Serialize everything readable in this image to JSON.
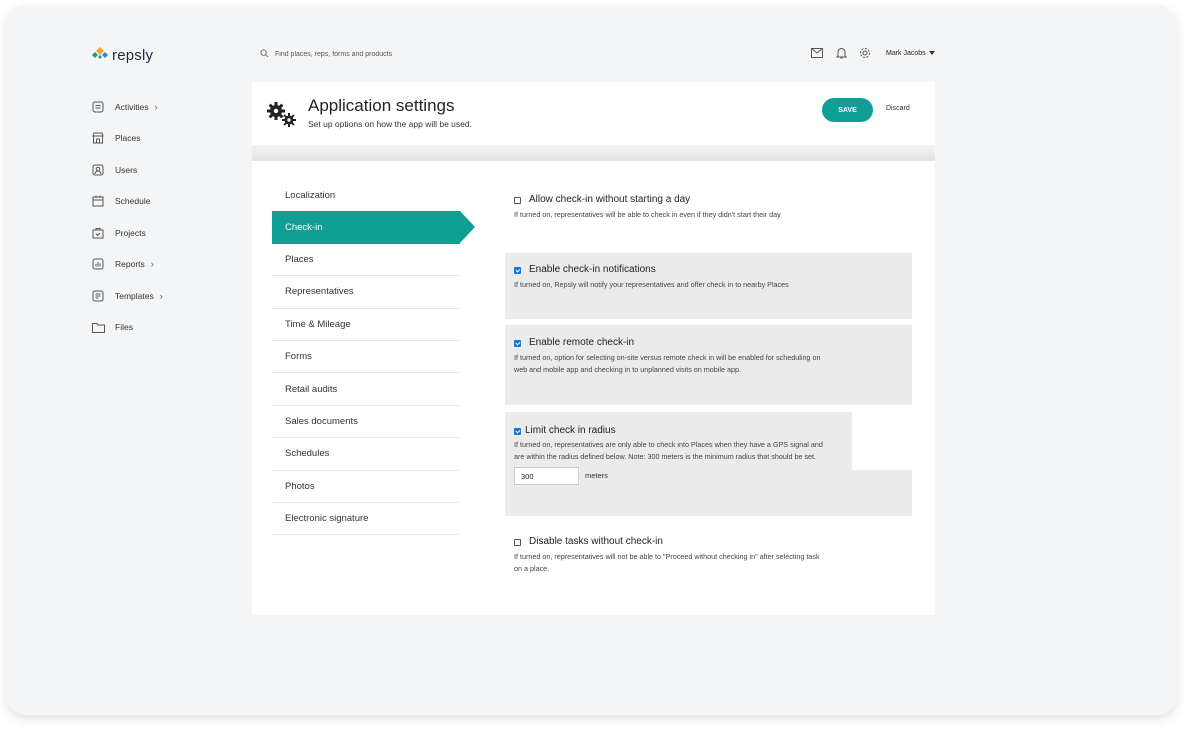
{
  "app": {
    "name": "repsly",
    "brand_color": "#0f9f95"
  },
  "search": {
    "placeholder": "Find places, reps, forms and products"
  },
  "user": {
    "name": "Mark Jacobs"
  },
  "icons": [
    "mail-icon",
    "bell-icon",
    "gear-icon",
    "search-icon",
    "caret-down-icon"
  ],
  "sidebar": {
    "items": [
      {
        "label": "Activities",
        "icon": "activities-icon",
        "has_chevron": true
      },
      {
        "label": "Places",
        "icon": "store-icon",
        "has_chevron": false
      },
      {
        "label": "Users",
        "icon": "user-icon",
        "has_chevron": false
      },
      {
        "label": "Schedule",
        "icon": "calendar-icon",
        "has_chevron": false
      },
      {
        "label": "Projects",
        "icon": "projects-icon",
        "has_chevron": false
      },
      {
        "label": "Reports",
        "icon": "chart-icon",
        "has_chevron": true
      },
      {
        "label": "Templates",
        "icon": "templates-icon",
        "has_chevron": true
      },
      {
        "label": "Files",
        "icon": "folder-icon",
        "has_chevron": false
      }
    ]
  },
  "header": {
    "title": "Application settings",
    "subtitle": "Set up options on how the app will be used.",
    "save_label": "SAVE",
    "discard_label": "Discard"
  },
  "settings_nav": {
    "active": "Check-in",
    "items": [
      "Localization",
      "Check-in",
      "Places",
      "Representatives",
      "Time & Mileage",
      "Forms",
      "Retail audits",
      "Sales documents",
      "Schedules",
      "Photos",
      "Electronic signature"
    ]
  },
  "options": [
    {
      "title": "Allow check-in without starting a day",
      "checked": false,
      "desc": "If turned on, representatives will be able to check in even if they didn't start their day"
    },
    {
      "title": "Enable check-in notifications",
      "checked": true,
      "desc": "If turned on, Repsly will notify your representatives and offer check in to nearby Places"
    },
    {
      "title": "Enable remote check-in",
      "checked": true,
      "desc": "If turned on, option for selecting on-site versus remote check in will be enabled for scheduling on web and mobile app and checking in to unplanned visits on mobile app."
    },
    {
      "title": "Limit check in radius",
      "checked": true,
      "desc": "If turned on, representatives are only able to check into Places when they have a GPS signal and are within the radius defined below. Note: 300 meters is the minimum radius that should be set.",
      "radius_value": "300",
      "radius_unit": "meters"
    },
    {
      "title": "Disable tasks without check-in",
      "checked": false,
      "desc": "If turned on, representatives will not be able to \"Proceed without checking in\" after selecting task on a place."
    }
  ]
}
